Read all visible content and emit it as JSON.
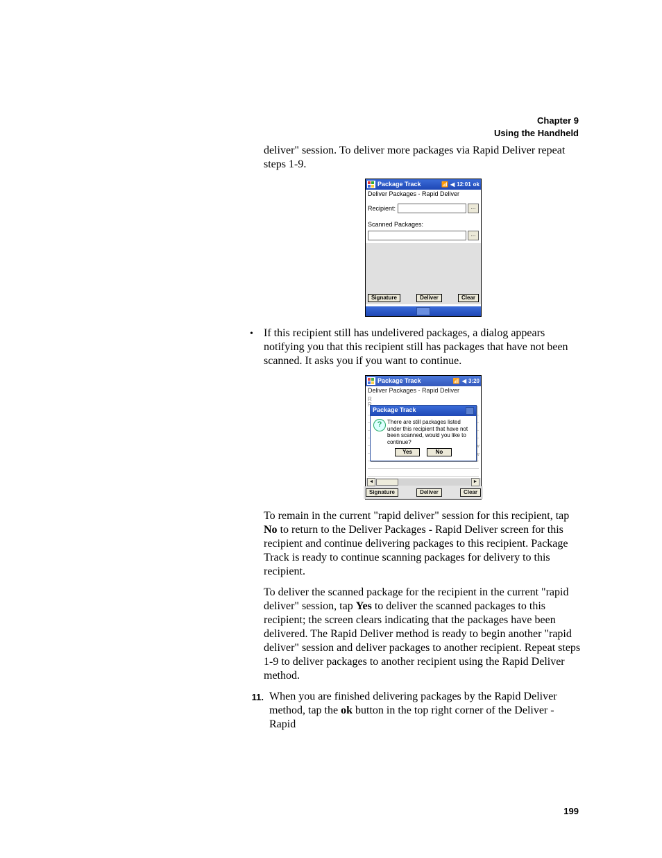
{
  "header": {
    "chapter": "Chapter 9",
    "section": "Using the Handheld"
  },
  "intro_fragment": "deliver\" session. To deliver more packages via Rapid Deliver repeat steps 1-9.",
  "pda1": {
    "title": "Package Track",
    "time": "12:01",
    "ok": "ok",
    "subtitle": "Deliver Packages - Rapid Deliver",
    "recipient_label": "Recipient:",
    "scanned_label": "Scanned Packages:",
    "btn_signature": "Signature",
    "btn_deliver": "Deliver",
    "btn_clear": "Clear",
    "ellipsis": "..."
  },
  "bullet_text": "If this recipient still has undelivered packages, a dialog appears notifying you that this recipient still has packages that have not been scanned. It asks you if you want to continue.",
  "pda2": {
    "title": "Package Track",
    "time": "3:20",
    "subtitle": "Deliver Packages - Rapid Deliver",
    "dlg_title": "Package Track",
    "dlg_msg": "There are still packages listed under this recipient that have not been scanned, would you like to continue?",
    "dlg_yes": "Yes",
    "dlg_no": "No",
    "btn_signature": "Signature",
    "btn_deliver": "Deliver",
    "btn_clear": "Clear",
    "edge1": "av",
    "edge2": "av",
    "bg_r1": "R",
    "bg_r2": "R",
    "scroll_left": "◄",
    "scroll_right": "►"
  },
  "para_no_pre": "To remain in the current \"rapid deliver\" session for this recipient, tap ",
  "bold_no": "No",
  "para_no_post": " to return to the Deliver Packages - Rapid Deliver screen for this recipient and continue delivering packages to this recipient. Package Track is ready to continue scanning packages for delivery to this recipient.",
  "para_yes_pre": "To deliver the scanned package for the recipient in the current \"rapid deliver\" session, tap ",
  "bold_yes": "Yes",
  "para_yes_post": " to deliver the scanned packages to this recipient; the screen clears indicating that the packages have been delivered. The Rapid Deliver method is ready to begin another \"rapid deliver\" session and deliver packages to another recipient. Repeat steps 1-9 to deliver packages to another recipient using the Rapid Deliver method.",
  "step11_num": "11.",
  "step11_pre": "When you are finished delivering packages by the Rapid Deliver method, tap the ",
  "bold_ok": "ok",
  "step11_post": " button in the top right corner of the Deliver - Rapid",
  "page_number": "199"
}
